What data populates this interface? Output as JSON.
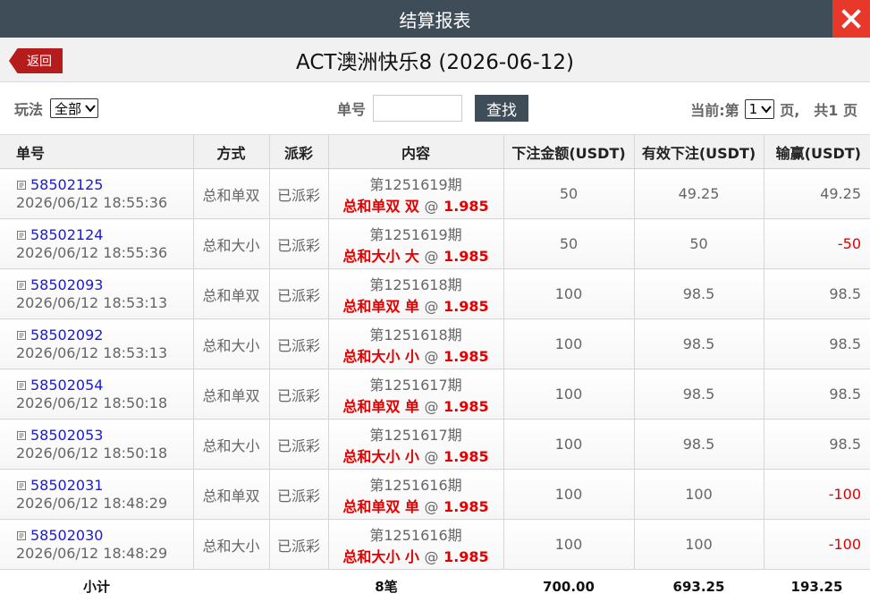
{
  "window": {
    "title": "结算报表"
  },
  "header": {
    "back_label": "返回",
    "page_title": "ACT澳洲快乐8 (2026-06-12)"
  },
  "filters": {
    "play_label": "玩法",
    "play_value": "全部",
    "order_label": "单号",
    "order_value": "",
    "search_label": "查找",
    "current_label": "当前:第",
    "page_value": "1",
    "page_unit": "页,",
    "total_label": "共1 页"
  },
  "table": {
    "columns": [
      "单号",
      "方式",
      "派彩",
      "内容",
      "下注金额(USDT)",
      "有效下注(USDT)",
      "输赢(USDT)"
    ],
    "rows": [
      {
        "id": "58502125",
        "time": "2026/06/12 18:55:36",
        "method": "总和单双",
        "status": "已派彩",
        "issue": "第1251619期",
        "bet": "总和单双 双",
        "at": "@",
        "odds": "1.985",
        "amount": "50",
        "valid": "49.25",
        "result": "49.25",
        "negative": false
      },
      {
        "id": "58502124",
        "time": "2026/06/12 18:55:36",
        "method": "总和大小",
        "status": "已派彩",
        "issue": "第1251619期",
        "bet": "总和大小 大",
        "at": "@",
        "odds": "1.985",
        "amount": "50",
        "valid": "50",
        "result": "-50",
        "negative": true
      },
      {
        "id": "58502093",
        "time": "2026/06/12 18:53:13",
        "method": "总和单双",
        "status": "已派彩",
        "issue": "第1251618期",
        "bet": "总和单双 单",
        "at": "@",
        "odds": "1.985",
        "amount": "100",
        "valid": "98.5",
        "result": "98.5",
        "negative": false
      },
      {
        "id": "58502092",
        "time": "2026/06/12 18:53:13",
        "method": "总和大小",
        "status": "已派彩",
        "issue": "第1251618期",
        "bet": "总和大小 小",
        "at": "@",
        "odds": "1.985",
        "amount": "100",
        "valid": "98.5",
        "result": "98.5",
        "negative": false
      },
      {
        "id": "58502054",
        "time": "2026/06/12 18:50:18",
        "method": "总和单双",
        "status": "已派彩",
        "issue": "第1251617期",
        "bet": "总和单双 单",
        "at": "@",
        "odds": "1.985",
        "amount": "100",
        "valid": "98.5",
        "result": "98.5",
        "negative": false
      },
      {
        "id": "58502053",
        "time": "2026/06/12 18:50:18",
        "method": "总和大小",
        "status": "已派彩",
        "issue": "第1251617期",
        "bet": "总和大小 小",
        "at": "@",
        "odds": "1.985",
        "amount": "100",
        "valid": "98.5",
        "result": "98.5",
        "negative": false
      },
      {
        "id": "58502031",
        "time": "2026/06/12 18:48:29",
        "method": "总和单双",
        "status": "已派彩",
        "issue": "第1251616期",
        "bet": "总和单双 单",
        "at": "@",
        "odds": "1.985",
        "amount": "100",
        "valid": "100",
        "result": "-100",
        "negative": true
      },
      {
        "id": "58502030",
        "time": "2026/06/12 18:48:29",
        "method": "总和大小",
        "status": "已派彩",
        "issue": "第1251616期",
        "bet": "总和大小 小",
        "at": "@",
        "odds": "1.985",
        "amount": "100",
        "valid": "100",
        "result": "-100",
        "negative": true
      }
    ],
    "summary": {
      "label": "小计",
      "count": "8笔",
      "amount": "700.00",
      "valid": "693.25",
      "result": "193.25"
    }
  },
  "colors": {
    "titlebar": "#3f4d58",
    "close": "#e8382a",
    "back": "#b71c1c",
    "link": "#1a1ad6",
    "negative": "#e00000"
  },
  "icons": {
    "close": "close-icon",
    "dropdown": "chevron-down-icon",
    "order": "document-icon"
  }
}
